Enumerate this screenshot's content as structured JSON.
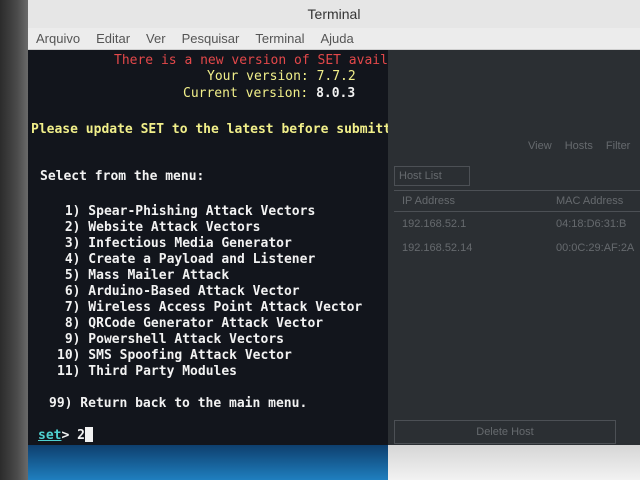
{
  "window": {
    "title": "Terminal"
  },
  "menu": [
    "Arquivo",
    "Editar",
    "Ver",
    "Pesquisar",
    "Terminal",
    "Ajuda"
  ],
  "terminal": {
    "update_notice": "There is a new version of SET available.",
    "your_version_label": "Your version:",
    "your_version": "7.7.2",
    "current_version_label": "Current version:",
    "current_version": "8.0.3",
    "warning": "Please update SET to the latest before submitting any git issues.",
    "menu_prompt": "Select from the menu:",
    "options": [
      " 1) Spear-Phishing Attack Vectors",
      " 2) Website Attack Vectors",
      " 3) Infectious Media Generator",
      " 4) Create a Payload and Listener",
      " 5) Mass Mailer Attack",
      " 6) Arduino-Based Attack Vector",
      " 7) Wireless Access Point Attack Vector",
      " 8) QRCode Generator Attack Vector",
      " 9) Powershell Attack Vectors",
      "10) SMS Spoofing Attack Vector",
      "11) Third Party Modules"
    ],
    "return_option": "99) Return back to the main menu.",
    "prompt": "set",
    "prompt_suffix": ">",
    "input": "2"
  },
  "background_app": {
    "toolbar": [
      "View",
      "Hosts",
      "Filter"
    ],
    "tab": "Host List",
    "columns": [
      "IP Address",
      "MAC Address"
    ],
    "rows": [
      {
        "ip": "192.168.52.1",
        "mac": "04:18:D6:31:B"
      },
      {
        "ip": "192.168.52.14",
        "mac": "00:0C:29:AF:2A"
      }
    ],
    "button": "Delete Host"
  },
  "colors": {
    "terminal_bg": "#12151c",
    "red": "#e3484a",
    "yellow": "#f1ef8a",
    "white": "#f2f2f2",
    "cyan": "#4fd1d1"
  }
}
